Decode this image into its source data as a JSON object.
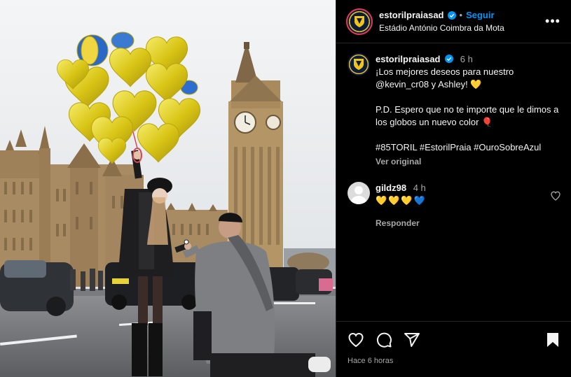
{
  "post": {
    "image_alt": "Pedido de casamento diante do Big Ben com balões dourados"
  },
  "header": {
    "username": "estorilpraiasad",
    "separator": "•",
    "follow_label": "Seguir",
    "location": "Estádio António Coimbra da Mota",
    "more_label": "•••"
  },
  "caption": {
    "username": "estorilpraiasad",
    "time": "6 h",
    "line1": "¡Los mejores deseos para nuestro @kevin_cr08 y Ashley! 💛",
    "line2": "P.D. Espero que no te importe que le dimos a los globos un nuevo color 🎈",
    "line3": "#85TORIL #EstorilPraia #OuroSobreAzul",
    "see_original": "Ver original"
  },
  "comment": {
    "username": "gildz98",
    "time": "4 h",
    "text": "💛💛💛💙",
    "reply_label": "Responder"
  },
  "footer": {
    "time_ago": "Hace 6 horas"
  },
  "colors": {
    "accent": "#0095f6",
    "background": "#000000",
    "border": "#262626",
    "secondary_text": "#a8a8a8",
    "balloon_gold": "#e2cf1c"
  }
}
